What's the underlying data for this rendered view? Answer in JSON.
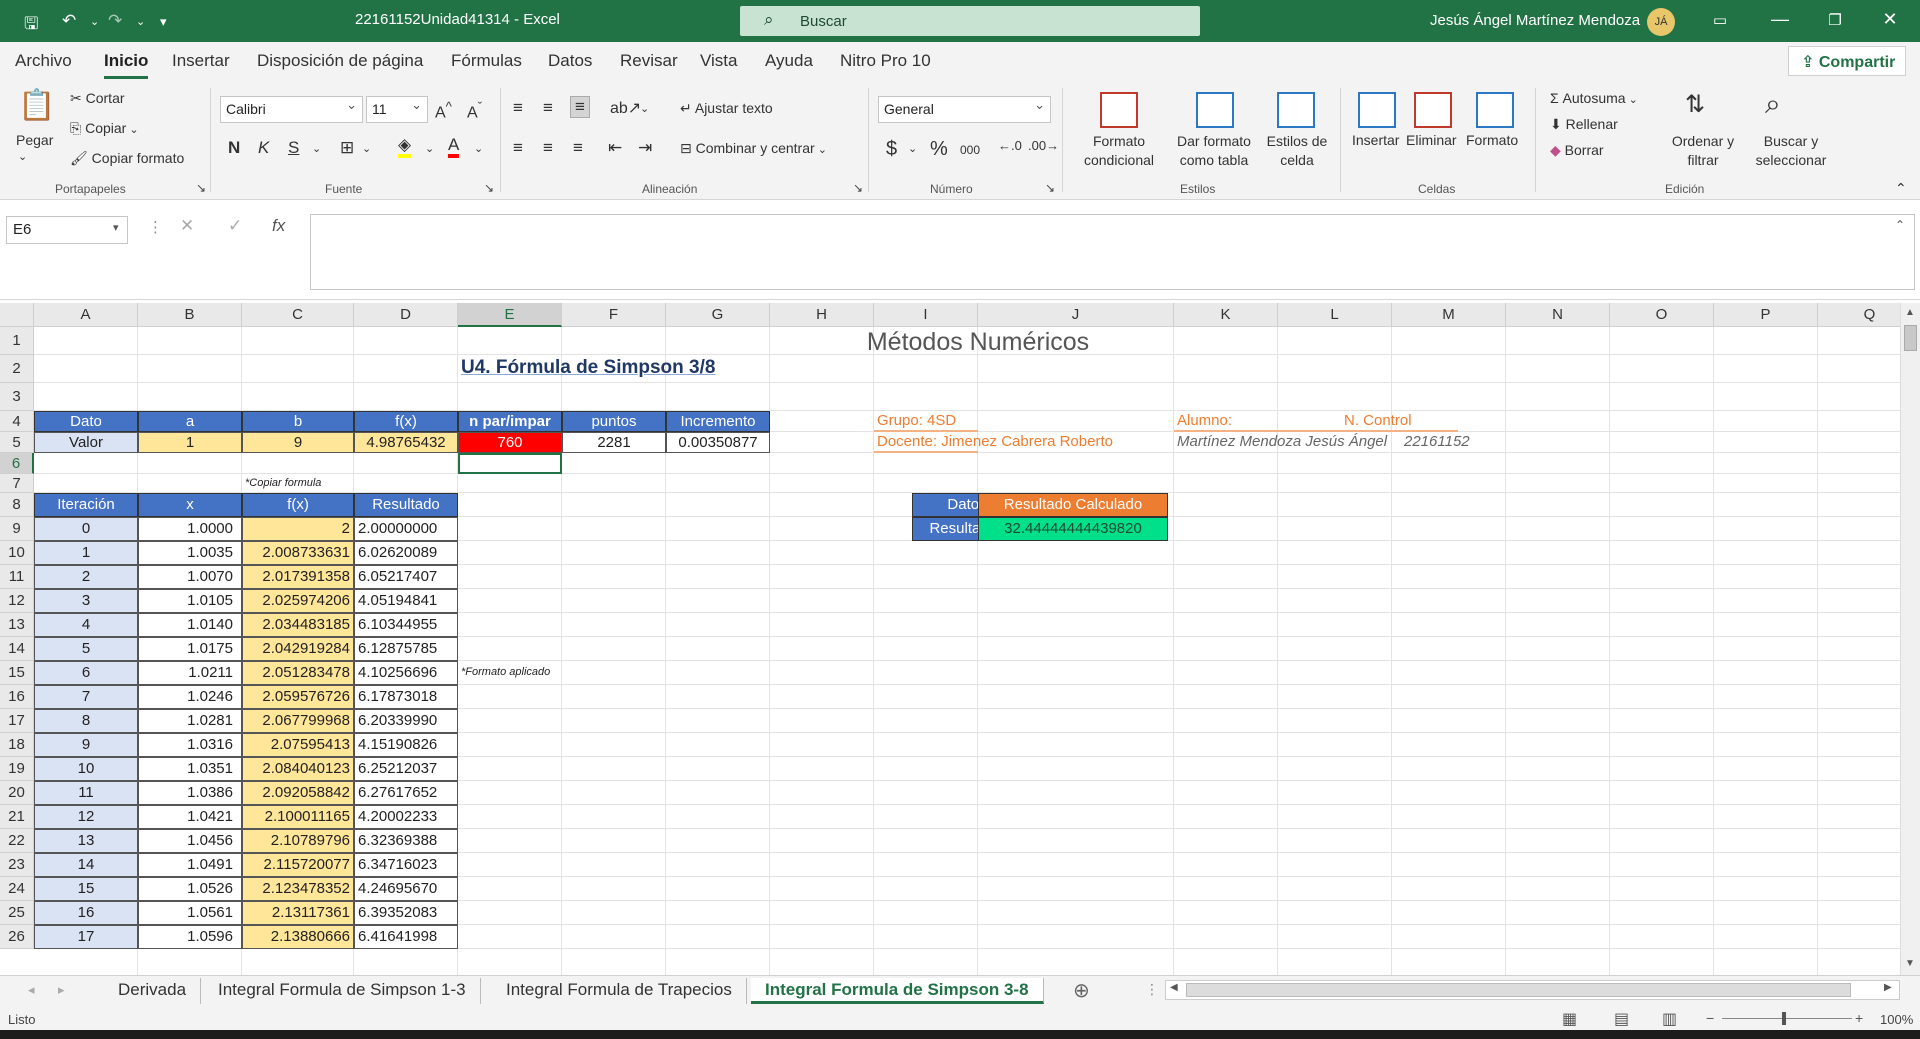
{
  "window": {
    "title": "22161152Unidad41314  -  Excel",
    "search_placeholder": "Buscar",
    "user_name": "Jesús Ángel Martínez Mendoza",
    "user_initials": "JÁ"
  },
  "menu": {
    "tabs": [
      "Archivo",
      "Inicio",
      "Insertar",
      "Disposición de página",
      "Fórmulas",
      "Datos",
      "Revisar",
      "Vista",
      "Ayuda",
      "Nitro Pro 10"
    ],
    "active": "Inicio",
    "share": "Compartir"
  },
  "ribbon": {
    "clipboard": {
      "paste": "Pegar",
      "cut": "Cortar",
      "copy": "Copiar",
      "format_painter": "Copiar formato",
      "label": "Portapapeles"
    },
    "font": {
      "name": "Calibri",
      "size": "11",
      "bold": "N",
      "italic": "K",
      "underline": "S",
      "label": "Fuente"
    },
    "alignment": {
      "wrap": "Ajustar texto",
      "merge": "Combinar y centrar",
      "label": "Alineación"
    },
    "number": {
      "format": "General",
      "currency": "$",
      "percent": "%",
      "thousands": "000",
      "label": "Número"
    },
    "styles": {
      "conditional": "Formato condicional",
      "as_table": "Dar formato como tabla",
      "cell_styles": "Estilos de celda",
      "label": "Estilos"
    },
    "cells": {
      "insert": "Insertar",
      "delete": "Eliminar",
      "format": "Formato",
      "label": "Celdas"
    },
    "editing": {
      "autosum": "Autosuma",
      "fill": "Rellenar",
      "clear": "Borrar",
      "sort": "Ordenar y filtrar",
      "find": "Buscar y seleccionar",
      "label": "Edición"
    }
  },
  "formula_bar": {
    "name_box": "E6",
    "fx": "fx",
    "content": ""
  },
  "columns": [
    "A",
    "B",
    "C",
    "D",
    "E",
    "F",
    "G",
    "H",
    "I",
    "J",
    "K",
    "L",
    "M",
    "N",
    "O",
    "P",
    "Q"
  ],
  "selected_cell": "E6",
  "sheet": {
    "title": "Métodos Numéricos",
    "subtitle": "U4. Fórmula de Simpson 3/8",
    "params_headers": [
      "Dato",
      "a",
      "b",
      "f(x)",
      "n par/impar",
      "puntos",
      "Incremento"
    ],
    "params_values": [
      "Valor",
      "1",
      "9",
      "4.98765432",
      "760",
      "2281",
      "0.00350877"
    ],
    "note_copy": "*Copiar formula",
    "note_format": "*Formato aplicado",
    "table_headers": [
      "Iteración",
      "x",
      "f(x)",
      "Resultado"
    ],
    "table_rows": [
      [
        "0",
        "1.0000",
        "2",
        "2.00000000"
      ],
      [
        "1",
        "1.0035",
        "2.008733631",
        "6.02620089"
      ],
      [
        "2",
        "1.0070",
        "2.017391358",
        "6.05217407"
      ],
      [
        "3",
        "1.0105",
        "2.025974206",
        "4.05194841"
      ],
      [
        "4",
        "1.0140",
        "2.034483185",
        "6.10344955"
      ],
      [
        "5",
        "1.0175",
        "2.042919284",
        "6.12875785"
      ],
      [
        "6",
        "1.0211",
        "2.051283478",
        "4.10256696"
      ],
      [
        "7",
        "1.0246",
        "2.059576726",
        "6.17873018"
      ],
      [
        "8",
        "1.0281",
        "2.067799968",
        "6.20339990"
      ],
      [
        "9",
        "1.0316",
        "2.07595413",
        "4.15190826"
      ],
      [
        "10",
        "1.0351",
        "2.084040123",
        "6.25212037"
      ],
      [
        "11",
        "1.0386",
        "2.092058842",
        "6.27617652"
      ],
      [
        "12",
        "1.0421",
        "2.100011165",
        "4.20002233"
      ],
      [
        "13",
        "1.0456",
        "2.10789796",
        "6.32369388"
      ],
      [
        "14",
        "1.0491",
        "2.115720077",
        "6.34716023"
      ],
      [
        "15",
        "1.0526",
        "2.123478352",
        "4.24695670"
      ],
      [
        "16",
        "1.0561",
        "2.13117361",
        "6.39352083"
      ],
      [
        "17",
        "1.0596",
        "2.13880666",
        "6.41641998"
      ]
    ],
    "group_label": "Grupo: 4SD",
    "teacher_label": "Docente: Jimenez Cabrera Roberto",
    "student_label": "Alumno:",
    "control_label": "N. Control",
    "student_name": "Martínez Mendoza Jesús Ángel",
    "control_number": "22161152",
    "result_header_left": "Datos",
    "result_header_right": "Resultado Calculado",
    "result_label": "Resultados",
    "result_value": "32.44444444439820"
  },
  "sheet_tabs": [
    "Derivada",
    "Integral Formula de Simpson 1-3",
    "Integral Formula de Trapecios",
    "Integral Formula de Simpson 3-8"
  ],
  "active_sheet": "Integral Formula de Simpson 3-8",
  "status": {
    "ready": "Listo",
    "zoom": "100%"
  },
  "colors": {
    "excel_green": "#217346",
    "header_blue": "#4472c4",
    "cell_yellow": "#ffe699",
    "cell_red": "#ff0000",
    "result_orange": "#ed7d31",
    "result_green": "#00e08a"
  }
}
